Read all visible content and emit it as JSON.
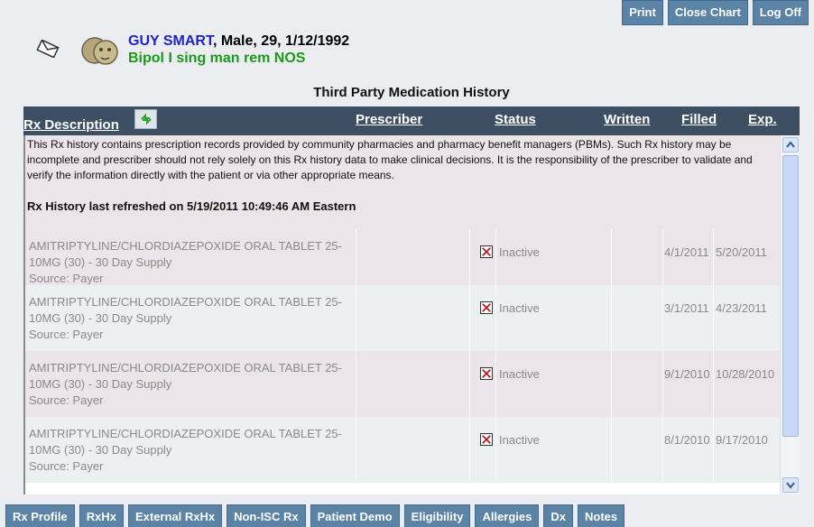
{
  "top_buttons": [
    "Print",
    "Close Chart",
    "Log Off"
  ],
  "patient": {
    "name": "GUY SMART",
    "info": ", Male, 29, 1/12/1992",
    "diagnosis": "Bipol I sing man rem NOS"
  },
  "section_title": "Third Party Medication History",
  "columns": {
    "rx_description": "Rx Description",
    "prescriber": "Prescriber",
    "status": "Status",
    "written": "Written",
    "filled": "Filled",
    "exp": "Exp."
  },
  "disclaimer": "This Rx history contains prescription records provided by community pharmacies and pharmacy benefit managers (PBMs). Such Rx history may be incomplete and prescriber should not rely solely on this Rx history data to make clinical decisions. It is the responsibility of the prescriber to validate and verify the information directly with the patient or via other appropriate means.",
  "refreshed": "Rx History last refreshed on 5/19/2011 10:49:46 AM Eastern",
  "rows": [
    {
      "drug": "AMITRIPTYLINE/CHLORDIAZEPOXIDE ORAL TABLET 25-10MG (30) - 30 Day Supply",
      "source": "Source: Payer",
      "status": "Inactive",
      "written": "4/1/2011",
      "filled": "5/20/2011"
    },
    {
      "drug": "AMITRIPTYLINE/CHLORDIAZEPOXIDE ORAL TABLET 25-10MG (30) - 30 Day Supply",
      "source": "Source: Payer",
      "status": "Inactive",
      "written": "3/1/2011",
      "filled": "4/23/2011"
    },
    {
      "drug": "AMITRIPTYLINE/CHLORDIAZEPOXIDE ORAL TABLET 25-10MG (30) - 30 Day Supply",
      "source": "Source: Payer",
      "status": "Inactive",
      "written": "9/1/2010",
      "filled": "10/28/2010"
    },
    {
      "drug": "AMITRIPTYLINE/CHLORDIAZEPOXIDE ORAL TABLET 25-10MG (30) - 30 Day Supply",
      "source": "Source: Payer",
      "status": "Inactive",
      "written": "8/1/2010",
      "filled": "9/17/2010"
    }
  ],
  "bottom_tabs": [
    "Rx Profile",
    "RxHx",
    "External RxHx",
    "Non-ISC Rx",
    "Patient Demo",
    "Eligibility",
    "Allergies",
    "Dx",
    "Notes"
  ],
  "colors": {
    "button": "#5a83a5",
    "header": "#3e4f63",
    "name": "#1e22c9",
    "diagnosis": "#1a9a1a"
  }
}
